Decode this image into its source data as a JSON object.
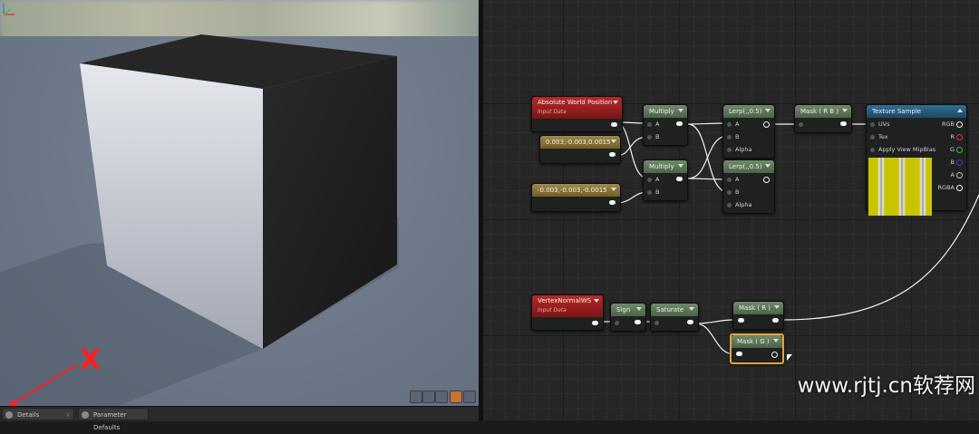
{
  "viewport": {
    "annotation_mark": "X",
    "gizmo_axes": [
      "x",
      "y",
      "z"
    ],
    "toolbar_icons": [
      "view-mode-icon",
      "shading-icon",
      "lit-icon",
      "realtime-icon",
      "settings-icon"
    ]
  },
  "tabs": [
    {
      "label": "Details"
    },
    {
      "label": "Parameter Defaults"
    }
  ],
  "nodes": {
    "absolute_world_position": {
      "title": "Absolute World Position",
      "subtitle": "Input Data"
    },
    "const_a": {
      "title": "0.003,-0.003,0.0015"
    },
    "const_b": {
      "title": "-0.003,-0.003,-0.0015"
    },
    "multiply_1": {
      "title": "Multiply",
      "pins": [
        "A",
        "B"
      ]
    },
    "multiply_2": {
      "title": "Multiply",
      "pins": [
        "A",
        "B"
      ]
    },
    "lerp_1": {
      "title": "Lerp(,,0.5)",
      "pins": [
        "A",
        "B",
        "Alpha"
      ]
    },
    "lerp_2": {
      "title": "Lerp(,,0.5)",
      "pins": [
        "A",
        "B",
        "Alpha"
      ]
    },
    "mask_rb": {
      "title": "Mask ( R B )"
    },
    "texture_sample": {
      "title": "Texture Sample",
      "inputs": [
        "UVs",
        "Tex",
        "Apply View MipBias"
      ],
      "outputs": [
        "RGB",
        "R",
        "G",
        "B",
        "A",
        "RGBA"
      ]
    },
    "vertex_normal_ws": {
      "title": "VertexNormalWS",
      "subtitle": "Input Data"
    },
    "sign": {
      "title": "Sign"
    },
    "saturate": {
      "title": "Saturate"
    },
    "mask_r": {
      "title": "Mask ( R )"
    },
    "mask_g": {
      "title": "Mask ( G )"
    }
  },
  "colors": {
    "accent_selected": "#e6a23a",
    "pin_r": "#e03030",
    "pin_g": "#30c030",
    "pin_b": "#3040d8"
  },
  "watermark": "www.rjtj.cn软荐网"
}
